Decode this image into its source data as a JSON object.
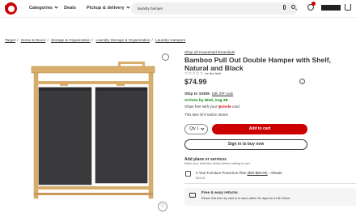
{
  "header": {
    "nav": [
      "Categories",
      "Deals",
      "Pickup & delivery"
    ],
    "search_value": "laundry hamper",
    "cart_badge": "3"
  },
  "breadcrumb": [
    "Target",
    "Home & Decor",
    "Storage & Organization",
    "Laundry Storage & Organization",
    "Laundry Hampers"
  ],
  "product": {
    "shop_all": "Shop all Household Essentials",
    "title": "Bamboo Pull Out Double Hamper with Shelf, Natural and Black",
    "stars": "☆☆☆☆☆",
    "reviews": "be the first!",
    "price": "$74.99",
    "ship_to_label": "Ship to 10306",
    "edit_zip": "Edit ZIP code",
    "arrives": "Arrives by Wed, Aug 28",
    "ships_free_prefix": "Ships free with your ",
    "ships_free_circle": "◎circle",
    "ships_free_suffix": " card",
    "not_sold": "This item isn't sold in stores"
  },
  "actions": {
    "qty_label": "Qty 1",
    "add_to_cart": "Add to cart",
    "sign_in": "Sign in to buy now"
  },
  "plans": {
    "title": "Add plans or services",
    "subtitle": "Make your selection below before adding to cart",
    "plan_name": "2 Year Furniture Protection Plan ",
    "plan_price": "($50-$99.99)",
    "plan_vendor": " - Allstate",
    "plan_cost": "$13.00"
  },
  "returns": {
    "title": "Free & easy returns",
    "subtitle": "Return this item by mail or in store within 30 days for a full refund."
  },
  "colors": {
    "brand_red": "#cc0000",
    "arrives_green": "#008300"
  }
}
